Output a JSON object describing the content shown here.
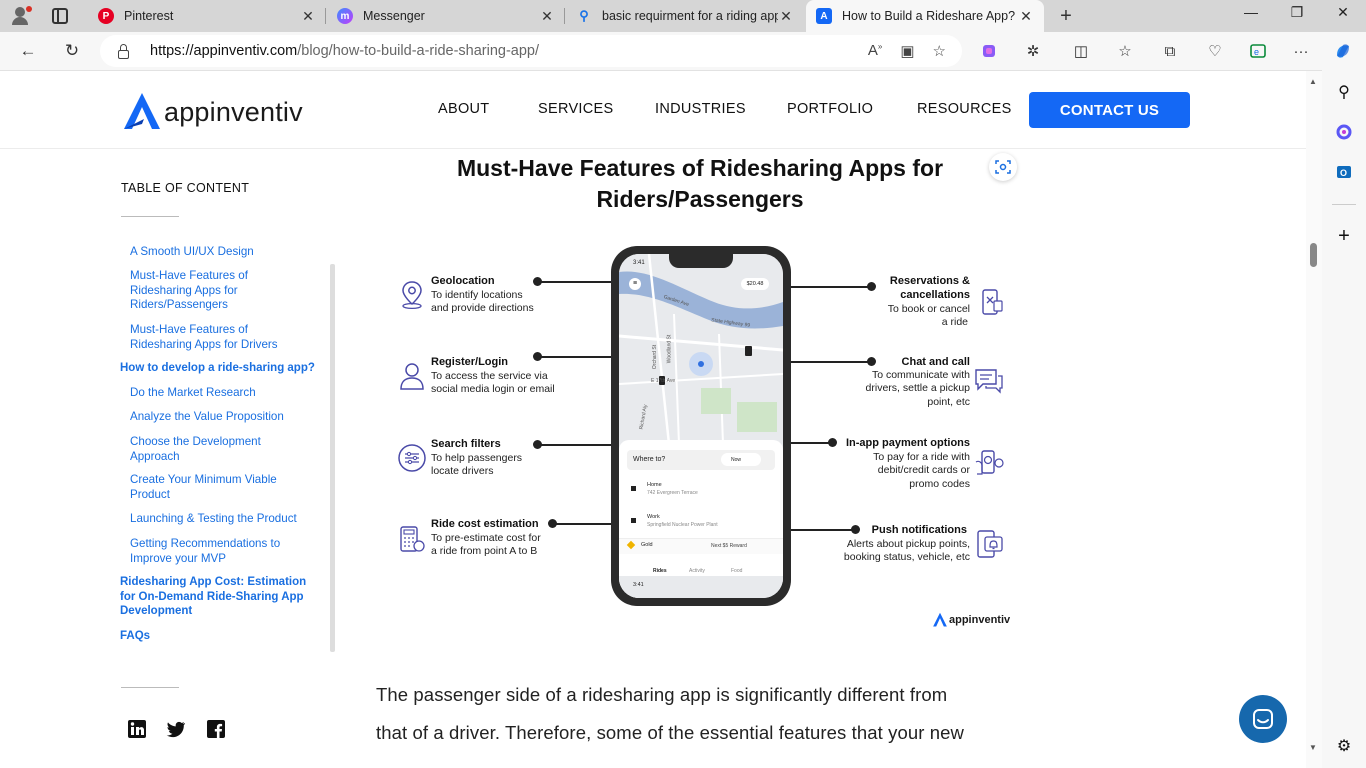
{
  "browser": {
    "tabs": [
      {
        "title": "Pinterest",
        "favicon": "pinterest-icon",
        "color": "#e60023"
      },
      {
        "title": "Messenger",
        "favicon": "messenger-icon",
        "color": "#a334fa"
      },
      {
        "title": "basic requirment for a riding app",
        "favicon": "search-icon",
        "color": "#1a73e8"
      },
      {
        "title": "How to Build a Rideshare App? F",
        "favicon": "appinventiv-icon",
        "color": "#1468f5",
        "active": true
      }
    ],
    "url_host": "https://appinventiv.com",
    "url_path": "/blog/how-to-build-a-ride-sharing-app/"
  },
  "site": {
    "logo_text": "appinventiv",
    "nav": [
      "ABOUT",
      "SERVICES",
      "INDUSTRIES",
      "PORTFOLIO",
      "RESOURCES"
    ],
    "cta": "CONTACT US",
    "brand_color": "#1468f5"
  },
  "toc": {
    "title": "TABLE OF CONTENT",
    "items": [
      {
        "label": "A Smooth UI/UX Design",
        "level": 2
      },
      {
        "label": "Must-Have Features of Ridesharing Apps for Riders/Passengers",
        "level": 2
      },
      {
        "label": "Must-Have Features of Ridesharing Apps for Drivers",
        "level": 2
      },
      {
        "label": "How to develop a ride-sharing app?",
        "level": 1
      },
      {
        "label": "Do the Market Research",
        "level": 2
      },
      {
        "label": "Analyze the Value Proposition",
        "level": 2
      },
      {
        "label": "Choose the Development Approach",
        "level": 2
      },
      {
        "label": "Create Your Minimum Viable Product",
        "level": 2
      },
      {
        "label": "Launching & Testing the Product",
        "level": 2
      },
      {
        "label": "Getting Recommendations to Improve your MVP",
        "level": 2
      },
      {
        "label": "Ridesharing App Cost: Estimation for On-Demand Ride-Sharing App Development",
        "level": 1
      },
      {
        "label": "FAQs",
        "level": 1
      }
    ],
    "social": [
      "linkedin-icon",
      "twitter-icon",
      "facebook-icon"
    ]
  },
  "figure": {
    "title": "Must-Have Features of Ridesharing Apps for Riders/Passengers",
    "left_features": [
      {
        "title": "Geolocation",
        "desc": [
          "To identify locations",
          "and provide directions"
        ]
      },
      {
        "title": "Register/Login",
        "desc": [
          "To access the service via",
          "social media login or email"
        ]
      },
      {
        "title": "Search filters",
        "desc": [
          "To help passengers",
          "locate drivers"
        ]
      },
      {
        "title": "Ride cost estimation",
        "desc": [
          "To pre-estimate cost for",
          "a ride from point A to B"
        ]
      }
    ],
    "right_features": [
      {
        "title": [
          "Reservations &",
          "cancellations"
        ],
        "desc": [
          "To book or cancel",
          "a ride"
        ]
      },
      {
        "title": [
          "Chat and call"
        ],
        "desc": [
          "To communicate with",
          "drivers, settle a pickup",
          "point, etc"
        ]
      },
      {
        "title": [
          "In-app payment options"
        ],
        "desc": [
          "To pay for a ride with",
          "debit/credit cards or",
          "promo codes"
        ]
      },
      {
        "title": [
          "Push notifications"
        ],
        "desc": [
          "Alerts about pickup points,",
          "booking status, vehicle, etc"
        ]
      }
    ],
    "phone": {
      "time": "3:41",
      "fare": "$20.48",
      "streets": [
        "Garden Ave",
        "State Highway 99",
        "Orchard St",
        "E 17th Ave",
        "Woodland St",
        "Richard Aly"
      ],
      "where_to": "Where to?",
      "now": "Now",
      "home_label": "Home",
      "home_addr": "742 Evergreen Terrace",
      "work_label": "Work",
      "work_addr": "Springfield Nuclear Power Plant",
      "gold": "Gold",
      "reward": "Next $5 Reward",
      "tabs": [
        "Rides",
        "Activity",
        "Food"
      ],
      "time2": "3:41"
    },
    "watermark": "appinventiv"
  },
  "article": {
    "lines": [
      "The passenger side of a ridesharing app is significantly different from",
      "that of a driver. Therefore, some of the essential features that your new"
    ]
  }
}
